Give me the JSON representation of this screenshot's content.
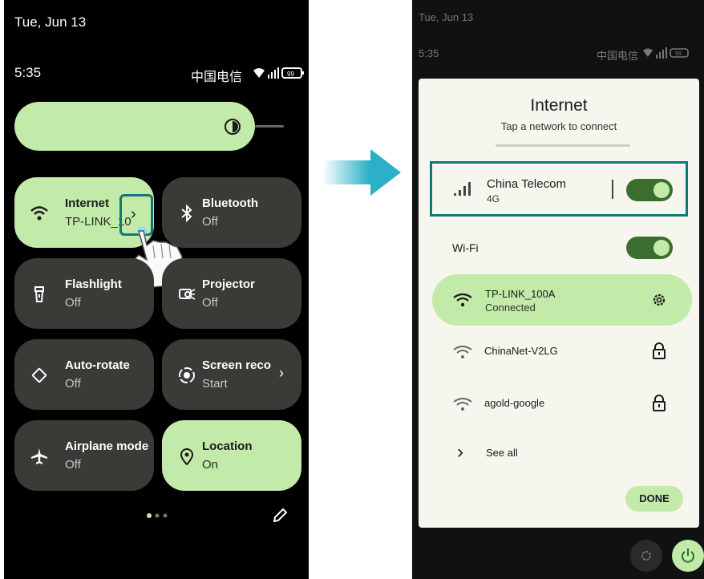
{
  "left": {
    "date": "Tue, Jun 13",
    "time": "5:35",
    "carrier": "中国电信",
    "battery": "99",
    "tiles": [
      {
        "label": "Internet",
        "sub": "TP-LINK_10",
        "icon": "wifi-icon"
      },
      {
        "label": "Bluetooth",
        "sub": "Off",
        "icon": "bluetooth-icon"
      },
      {
        "label": "Flashlight",
        "sub": "Off",
        "icon": "flashlight-icon"
      },
      {
        "label": "Projector",
        "sub": "Off",
        "icon": "projector-icon"
      },
      {
        "label": "Auto-rotate",
        "sub": "Off",
        "icon": "auto-rotate-icon"
      },
      {
        "label": "Screen reco",
        "sub": "Start",
        "icon": "screen-record-icon"
      },
      {
        "label": "Airplane mode",
        "sub": "Off",
        "icon": "airplane-icon"
      },
      {
        "label": "Location",
        "sub": "On",
        "icon": "location-icon"
      }
    ]
  },
  "right": {
    "date": "Tue, Jun 13",
    "time": "5:35",
    "carrier": "中国电信",
    "battery": "99",
    "panel": {
      "title": "Internet",
      "subtitle": "Tap a network to connect",
      "mobile_name": "China Telecom",
      "mobile_sub": "4G",
      "wifi_label": "Wi-Fi",
      "networks": [
        {
          "name": "TP-LINK_100A",
          "sub": "Connected"
        },
        {
          "name": "ChinaNet-V2LG",
          "sub": ""
        },
        {
          "name": "agold-google",
          "sub": ""
        }
      ],
      "see_all": "See all",
      "done": "DONE"
    }
  },
  "colors": {
    "accent": "#c2eaa8",
    "tile_dark": "#3a3a37",
    "highlight": "#107878",
    "arrow": "#2cb0c8"
  }
}
